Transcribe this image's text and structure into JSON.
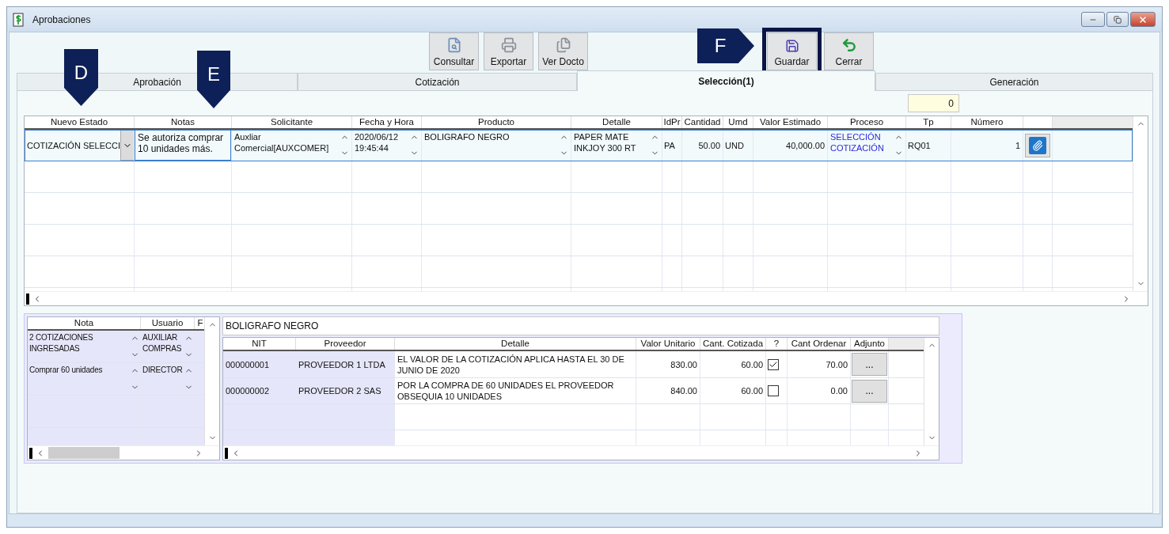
{
  "window": {
    "title": "Aprobaciones"
  },
  "toolbar": {
    "left": [
      {
        "label": "Consultar",
        "kind": "search",
        "framed": false
      },
      {
        "label": "Exportar",
        "kind": "export",
        "framed": false
      },
      {
        "label": "Ver Docto",
        "kind": "view",
        "framed": false
      }
    ],
    "right": [
      {
        "label": "Guardar",
        "kind": "save",
        "framed": true
      },
      {
        "label": "Cerrar",
        "kind": "close",
        "framed": false
      }
    ]
  },
  "annotations": [
    {
      "label": "D",
      "kind": "down"
    },
    {
      "label": "E",
      "kind": "down"
    },
    {
      "label": "F",
      "kind": "right"
    }
  ],
  "tabs": [
    {
      "label": "Aprobación",
      "selected": false
    },
    {
      "label": "Cotización",
      "selected": false
    },
    {
      "label": "Selección(1)",
      "selected": true
    },
    {
      "label": "Generación",
      "selected": false
    }
  ],
  "counter": "0",
  "requests": {
    "columns": [
      "Nuevo Estado",
      "Notas",
      "Solicitante",
      "Fecha y Hora",
      "Producto",
      "Detalle",
      "IdPr",
      "Cantidad",
      "Umd",
      "Valor Estimado",
      "Proceso",
      "Tp",
      "Número"
    ],
    "rows": [
      {
        "selected": true,
        "cells": [
          {
            "kind": "dropdown",
            "text": "COTIZACIÓN SELECCI"
          },
          {
            "kind": "edit",
            "text": "Se autoriza comprar 10 unidades más."
          },
          {
            "kind": "spin",
            "text": "Auxliar Comercial[AUXCOMER]"
          },
          {
            "kind": "spin",
            "text": "2020/06/12 19:45:44"
          },
          {
            "kind": "spin",
            "text": "BOLIGRAFO NEGRO"
          },
          {
            "kind": "spin",
            "text": "PAPER MATE INKJOY 300 RT"
          },
          {
            "kind": "plain",
            "text": "PA"
          },
          {
            "kind": "number",
            "text": "50.00"
          },
          {
            "kind": "plain",
            "text": "UND"
          },
          {
            "kind": "number",
            "text": "40,000.00"
          },
          {
            "kind": "link",
            "text": "SELECCIÓN COTIZACIÓN"
          },
          {
            "kind": "plain",
            "text": "RQ01"
          },
          {
            "kind": "number",
            "text": "1"
          },
          {
            "kind": "attach"
          }
        ]
      }
    ]
  },
  "notes": {
    "columns": [
      "Nota",
      "Usuario",
      "F"
    ],
    "rows": [
      {
        "cells": [
          "2 COTIZACIONES INGRESADAS",
          "AUXILIAR COMPRAS"
        ]
      },
      {
        "cells": [
          "Comprar 60 unidades",
          "DIRECTOR"
        ]
      }
    ]
  },
  "product": "BOLIGRAFO NEGRO",
  "suppliers": {
    "columns": [
      "NIT",
      "Proveedor",
      "Detalle",
      "Valor Unitario",
      "Cant. Cotizada",
      "?",
      "Cant Ordenar",
      "Adjunto"
    ],
    "rows": [
      {
        "nit": "000000001",
        "provider": "PROVEEDOR 1 LTDA",
        "detail": "EL VALOR DE LA COTIZACIÓN APLICA HASTA EL 30 DE JUNIO DE 2020",
        "unit_value": "830.00",
        "quoted": "60.00",
        "checked": true,
        "to_order": "70.00",
        "attachment": "..."
      },
      {
        "nit": "000000002",
        "provider": "PROVEEDOR 2 SAS",
        "detail": "POR LA COMPRA DE 60 UNIDADES EL PROVEEDOR OBSEQUIA 10 UNIDADES",
        "unit_value": "840.00",
        "quoted": "60.00",
        "checked": false,
        "to_order": "0.00",
        "attachment": "..."
      }
    ]
  }
}
